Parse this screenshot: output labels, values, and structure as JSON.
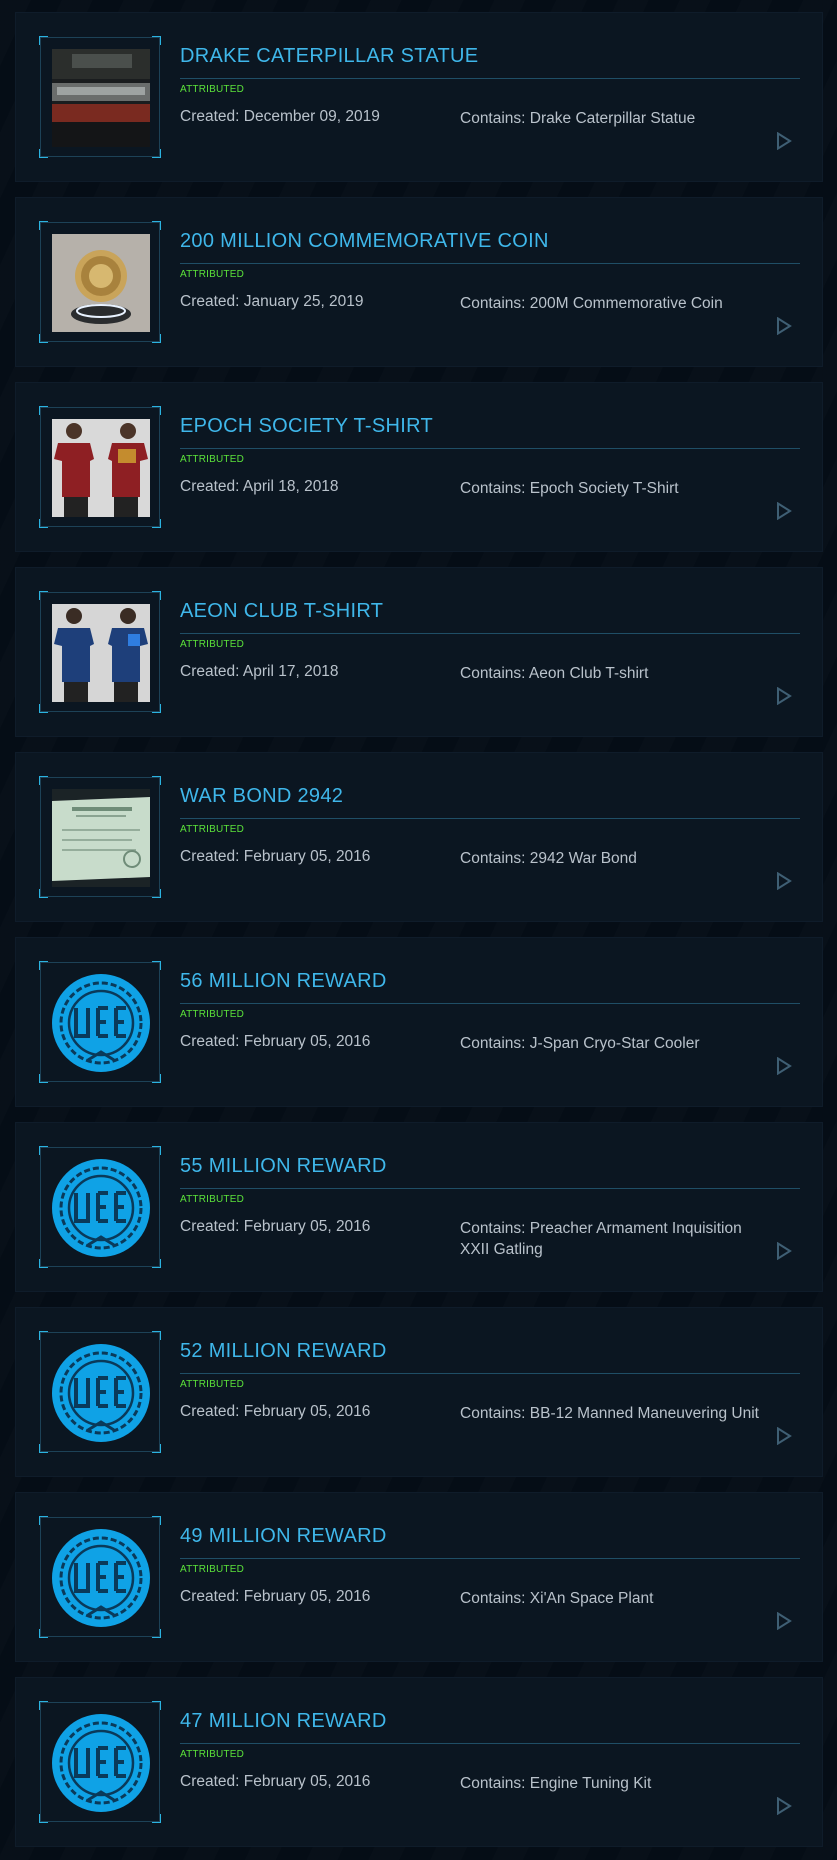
{
  "pledges": [
    {
      "title": "DRAKE CATERPILLAR STATUE",
      "status": "ATTRIBUTED",
      "created": "Created: December 09, 2019",
      "contains": "Contains: Drake Caterpillar Statue",
      "thumbnail": "caterpillar-statue-image"
    },
    {
      "title": "200 MILLION COMMEMORATIVE COIN",
      "status": "ATTRIBUTED",
      "created": "Created: January 25, 2019",
      "contains": "Contains: 200M Commemorative Coin",
      "thumbnail": "commemorative-coin-image"
    },
    {
      "title": "EPOCH SOCIETY T-SHIRT",
      "status": "ATTRIBUTED",
      "created": "Created: April 18, 2018",
      "contains": "Contains: Epoch Society T-Shirt",
      "thumbnail": "red-tshirt-image"
    },
    {
      "title": "AEON CLUB T-SHIRT",
      "status": "ATTRIBUTED",
      "created": "Created: April 17, 2018",
      "contains": "Contains: Aeon Club T-shirt",
      "thumbnail": "blue-tshirt-image"
    },
    {
      "title": "WAR BOND 2942",
      "status": "ATTRIBUTED",
      "created": "Created: February 05, 2016",
      "contains": "Contains: 2942 War Bond",
      "thumbnail": "war-bond-certificate-image"
    },
    {
      "title": "56 MILLION REWARD",
      "status": "ATTRIBUTED",
      "created": "Created: February 05, 2016",
      "contains": "Contains: J-Span Cryo-Star Cooler",
      "thumbnail": "uee-logo-icon"
    },
    {
      "title": "55 MILLION REWARD",
      "status": "ATTRIBUTED",
      "created": "Created: February 05, 2016",
      "contains": "Contains: Preacher Armament Inquisition XXII Gatling",
      "thumbnail": "uee-logo-icon"
    },
    {
      "title": "52 MILLION REWARD",
      "status": "ATTRIBUTED",
      "created": "Created: February 05, 2016",
      "contains": "Contains: BB-12 Manned Maneuvering Unit",
      "thumbnail": "uee-logo-icon"
    },
    {
      "title": "49 MILLION REWARD",
      "status": "ATTRIBUTED",
      "created": "Created: February 05, 2016",
      "contains": "Contains: Xi'An Space Plant",
      "thumbnail": "uee-logo-icon"
    },
    {
      "title": "47 MILLION REWARD",
      "status": "ATTRIBUTED",
      "created": "Created: February 05, 2016",
      "contains": "Contains: Engine Tuning Kit",
      "thumbnail": "uee-logo-icon"
    }
  ],
  "colors": {
    "title": "#3fb7ea",
    "status": "#5be23a",
    "body_text": "#b9c2cb",
    "card_bg": "#0b1621",
    "page_bg": "#050d16"
  }
}
